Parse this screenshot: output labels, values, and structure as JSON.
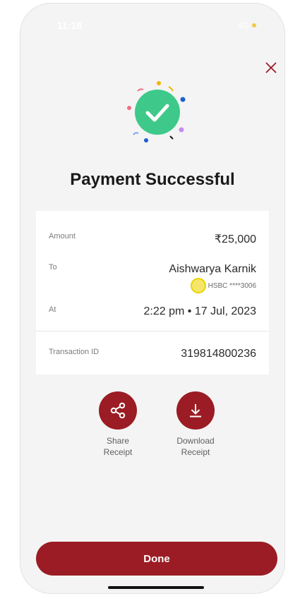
{
  "status_bar": {
    "time": "11:18",
    "network": "4G"
  },
  "colors": {
    "brand": "#9b1c24",
    "success": "#3ec98a"
  },
  "icons": {
    "close": "close-icon",
    "success": "checkmark-icon",
    "share": "share-icon",
    "download": "download-icon"
  },
  "title": "Payment Successful",
  "details": {
    "amount": {
      "label": "Amount",
      "value": "₹25,000"
    },
    "to": {
      "label": "To",
      "name": "Aishwarya Karnik",
      "account": "HSBC ****3006"
    },
    "at": {
      "label": "At",
      "value": "2:22 pm • 17 Jul, 2023"
    },
    "transaction": {
      "label": "Transaction ID",
      "value": "319814800236"
    }
  },
  "actions": {
    "share": {
      "line1": "Share",
      "line2": "Receipt"
    },
    "download": {
      "line1": "Download",
      "line2": "Receipt"
    }
  },
  "done_label": "Done"
}
